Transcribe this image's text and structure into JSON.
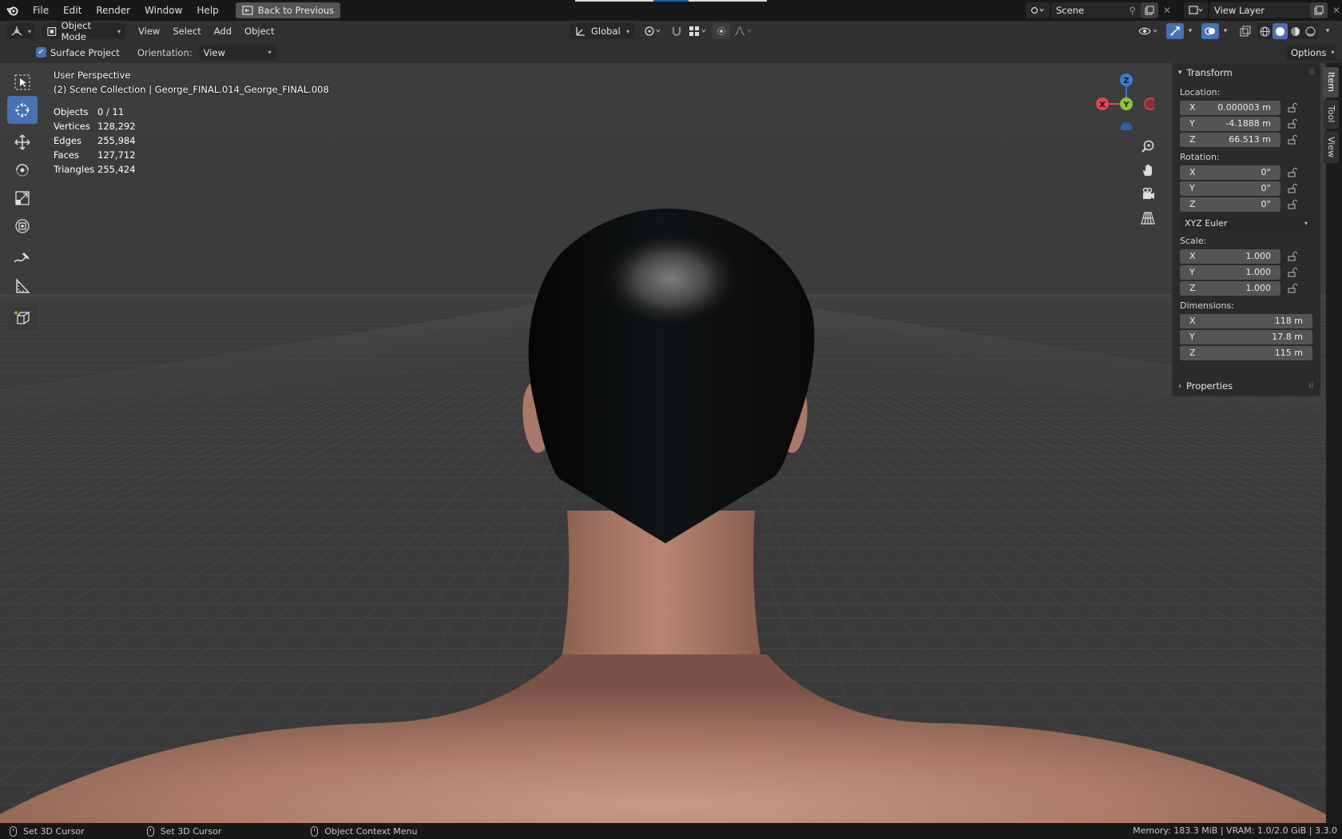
{
  "menubar": {
    "items": [
      "File",
      "Edit",
      "Render",
      "Window",
      "Help"
    ],
    "back_button": "Back to Previous"
  },
  "scene": {
    "name": "Scene",
    "view_layer": "View Layer"
  },
  "header": {
    "mode": "Object Mode",
    "menus": [
      "View",
      "Select",
      "Add",
      "Object"
    ],
    "transform_orientation": "Global"
  },
  "tool_settings": {
    "surface_project_label": "Surface Project",
    "surface_project_checked": true,
    "orientation_label": "Orientation:",
    "orientation_value": "View",
    "options_label": "Options"
  },
  "viewport": {
    "perspective": "User Perspective",
    "collection": "(2) Scene Collection | George_FINAL.014_George_FINAL.008",
    "stats": [
      {
        "label": "Objects",
        "value": "0 / 11"
      },
      {
        "label": "Vertices",
        "value": "128,292"
      },
      {
        "label": "Edges",
        "value": "255,984"
      },
      {
        "label": "Faces",
        "value": "127,712"
      },
      {
        "label": "Triangles",
        "value": "255,424"
      }
    ],
    "gizmo_axes": {
      "x": "X",
      "y": "Y",
      "z": "Z"
    }
  },
  "sidebar": {
    "tabs": [
      "Item",
      "Tool",
      "View"
    ],
    "active_tab": "Item",
    "transform_title": "Transform",
    "location_label": "Location:",
    "location": [
      {
        "axis": "X",
        "value": "0.000003 m"
      },
      {
        "axis": "Y",
        "value": "-4.1888 m"
      },
      {
        "axis": "Z",
        "value": "66.513 m"
      }
    ],
    "rotation_label": "Rotation:",
    "rotation": [
      {
        "axis": "X",
        "value": "0°"
      },
      {
        "axis": "Y",
        "value": "0°"
      },
      {
        "axis": "Z",
        "value": "0°"
      }
    ],
    "rotation_mode": "XYZ Euler",
    "scale_label": "Scale:",
    "scale": [
      {
        "axis": "X",
        "value": "1.000"
      },
      {
        "axis": "Y",
        "value": "1.000"
      },
      {
        "axis": "Z",
        "value": "1.000"
      }
    ],
    "dimensions_label": "Dimensions:",
    "dimensions": [
      {
        "axis": "X",
        "value": "118 m"
      },
      {
        "axis": "Y",
        "value": "17.8 m"
      },
      {
        "axis": "Z",
        "value": "115 m"
      }
    ],
    "properties_title": "Properties"
  },
  "statusbar": {
    "left_mouse": "Set 3D Cursor",
    "middle_mouse": "Set 3D Cursor",
    "right_mouse": "Object Context Menu",
    "info": "Memory: 183.3 MiB | VRAM: 1.0/2.0 GiB | 3.3.0"
  },
  "colors": {
    "accent": "#4772b3",
    "axis_x": "#e04555",
    "axis_y": "#8cc43a",
    "axis_z": "#3e7bd6",
    "hair": "#0b0b0b",
    "skin": "#b98573"
  }
}
